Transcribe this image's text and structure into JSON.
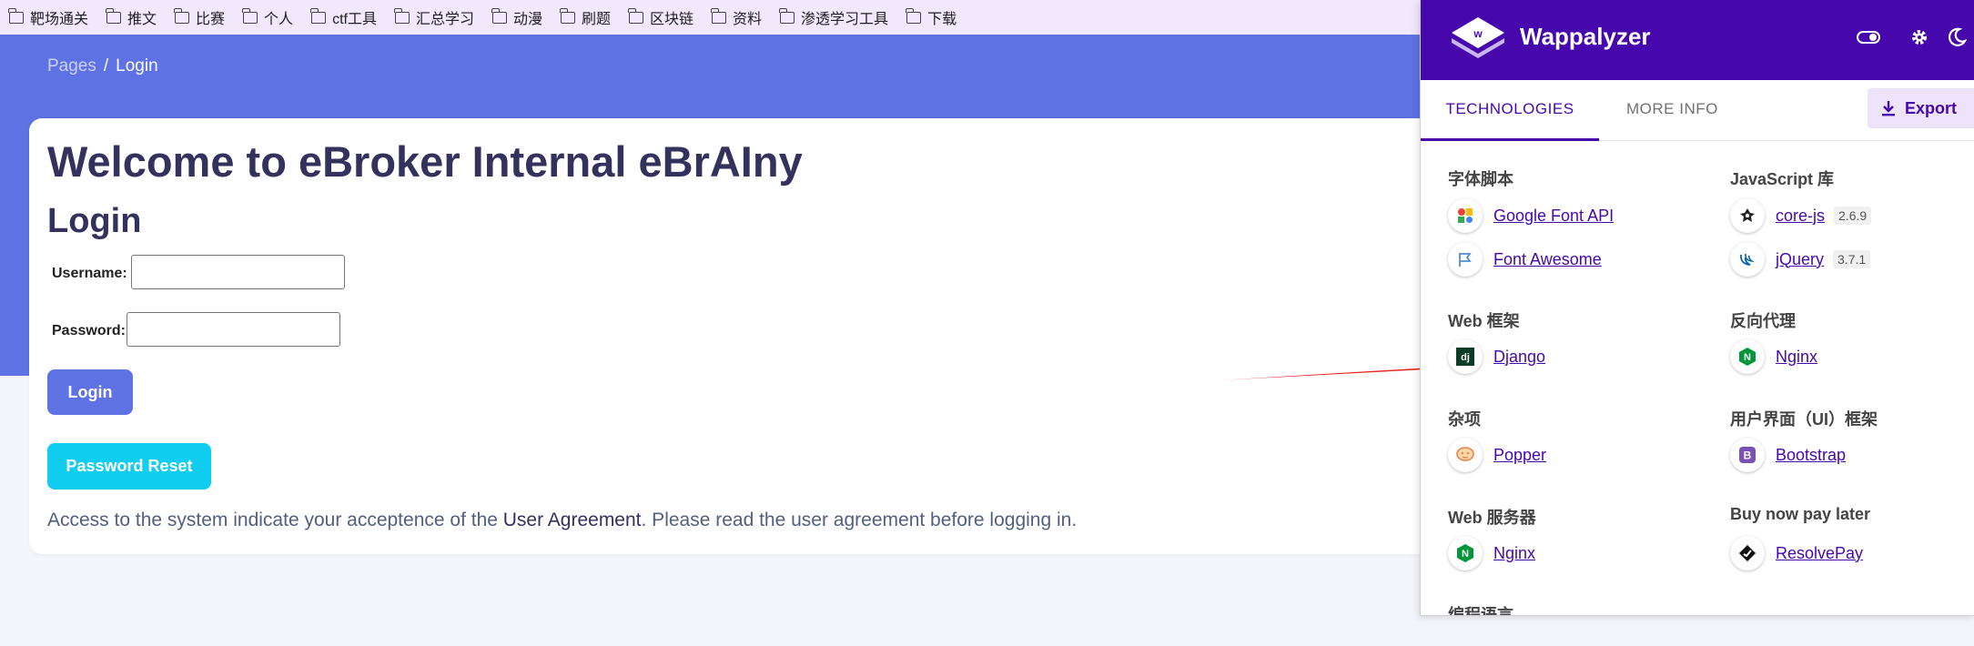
{
  "bookmarks": [
    "靶场通关",
    "推文",
    "比赛",
    "个人",
    "ctf工具",
    "汇总学习",
    "动漫",
    "刷题",
    "区块链",
    "资料",
    "渗透学习工具",
    "下载"
  ],
  "breadcrumb": {
    "parent": "Pages",
    "separator": "/",
    "current": "Login"
  },
  "page": {
    "welcome": "Welcome to eBroker Internal eBrAIny",
    "login_heading": "Login",
    "username_label": "Username:",
    "password_label": "Password:",
    "login_button": "Login",
    "reset_button": "Password Reset",
    "agreement_prefix": "Access to the system indicate your acceptence of the ",
    "agreement_link": "User Agreement",
    "agreement_suffix": ". Please read the user agreement before logging in."
  },
  "wappalyzer": {
    "title": "Wappalyzer",
    "tabs": [
      "TECHNOLOGIES",
      "MORE INFO"
    ],
    "export_label": "Export",
    "categories": [
      {
        "name": "字体脚本",
        "items": [
          {
            "name": "Google Font API",
            "icon": "google-font-icon"
          },
          {
            "name": "Font Awesome",
            "icon": "font-awesome-icon"
          }
        ]
      },
      {
        "name": "JavaScript 库",
        "items": [
          {
            "name": "core-js",
            "version": "2.6.9",
            "icon": "core-js-icon"
          },
          {
            "name": "jQuery",
            "version": "3.7.1",
            "icon": "jquery-icon"
          }
        ]
      },
      {
        "name": "Web 框架",
        "items": [
          {
            "name": "Django",
            "icon": "django-icon"
          }
        ]
      },
      {
        "name": "反向代理",
        "items": [
          {
            "name": "Nginx",
            "icon": "nginx-icon"
          }
        ]
      },
      {
        "name": "杂项",
        "items": [
          {
            "name": "Popper",
            "icon": "popper-icon"
          }
        ]
      },
      {
        "name": "用户界面（UI）框架",
        "items": [
          {
            "name": "Bootstrap",
            "icon": "bootstrap-icon"
          }
        ]
      },
      {
        "name": "Web 服务器",
        "items": [
          {
            "name": "Nginx",
            "icon": "nginx-icon"
          }
        ]
      },
      {
        "name": "Buy now pay later",
        "items": [
          {
            "name": "ResolvePay",
            "icon": "resolvepay-icon"
          }
        ]
      },
      {
        "name": "编程语言",
        "items": []
      }
    ]
  },
  "colors": {
    "hero": "#5e72e4",
    "wappalyzer_purple": "#4608ad",
    "reset_button": "#11cdef",
    "arrow": "#e8231e"
  }
}
